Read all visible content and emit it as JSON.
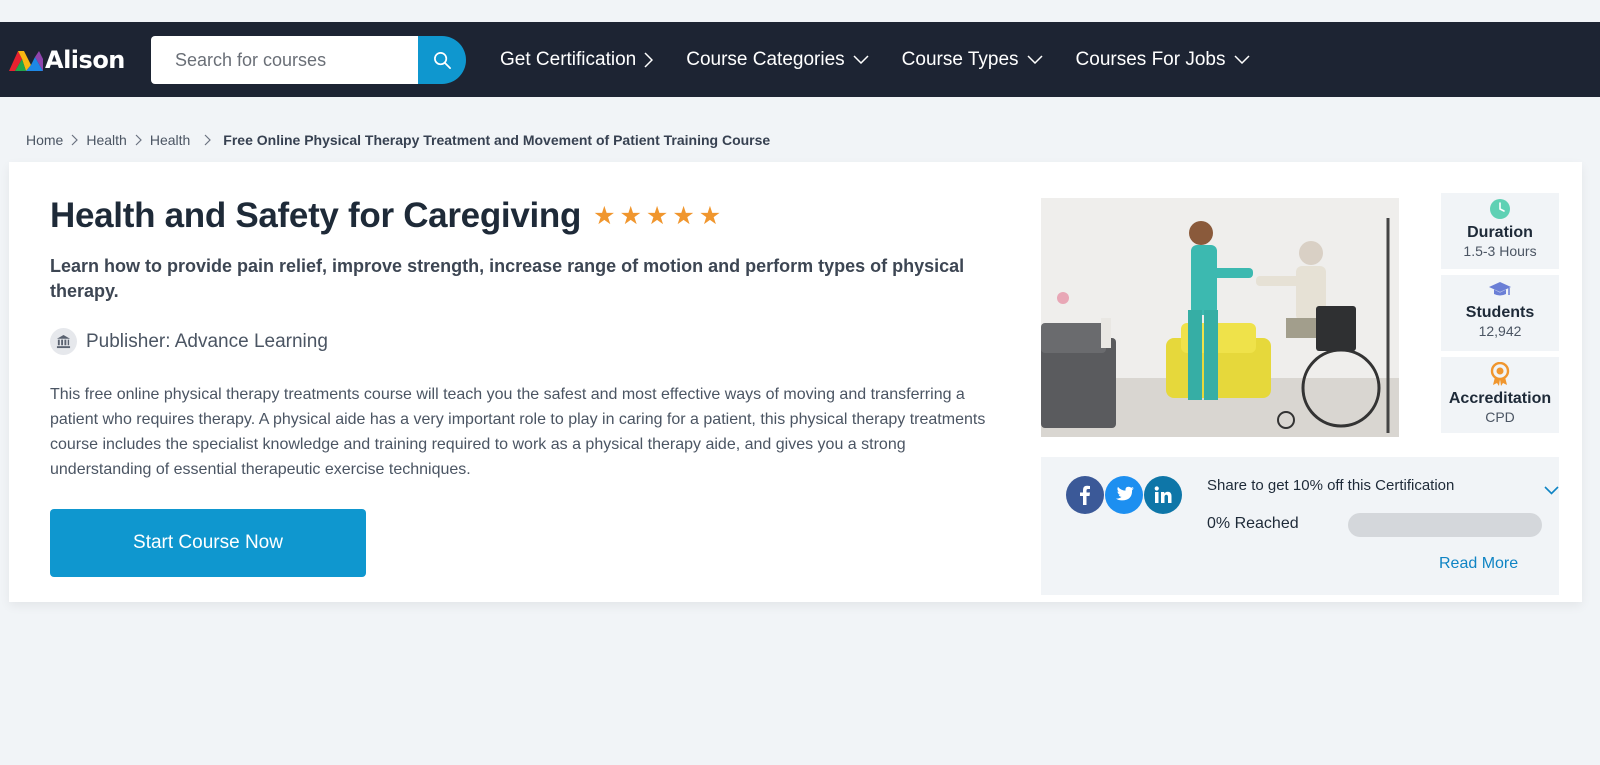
{
  "header": {
    "logo_text": "Alison",
    "search_placeholder": "Search for courses",
    "nav": [
      {
        "label": "Get Certification",
        "icon": "chevron-right-icon"
      },
      {
        "label": "Course Categories",
        "icon": "chevron-down-icon"
      },
      {
        "label": "Course Types",
        "icon": "chevron-down-icon"
      },
      {
        "label": "Courses For Jobs",
        "icon": "chevron-down-icon"
      }
    ]
  },
  "breadcrumb": [
    "Home",
    "Health",
    "Health",
    "Free Online Physical Therapy Treatment and Movement of Patient Training Course"
  ],
  "course": {
    "title": "Health and Safety for Caregiving",
    "rating": 5,
    "subtitle": "Learn how to provide pain relief, improve strength, increase range of motion and perform types of physical therapy.",
    "publisher": "Publisher: Advance Learning",
    "description": "This free online physical therapy treatments course will teach you the safest and most effective ways of moving and transferring a patient who requires therapy. A physical aide has a very important role to play in caring for a patient, this physical therapy treatments course includes the specialist knowledge and training required to work as a physical therapy aide, and gives you a strong understanding of essential therapeutic exercise techniques.",
    "start_button": "Start Course Now"
  },
  "stats": [
    {
      "label": "Duration",
      "value": "1.5-3 Hours",
      "icon": "clock-icon",
      "color": "#5fd1b4"
    },
    {
      "label": "Students",
      "value": "12,942",
      "icon": "graduation-cap-icon",
      "color": "#6b7fd6"
    },
    {
      "label": "Accreditation",
      "value": "CPD",
      "icon": "award-icon",
      "color": "#f0962e"
    }
  ],
  "share": {
    "text": "Share to get 10% off this Certification",
    "reached": "0% Reached",
    "progress": 0,
    "read_more": "Read More",
    "networks": [
      {
        "name": "facebook-icon",
        "color": "#3b5998"
      },
      {
        "name": "twitter-icon",
        "color": "#1d8ff0"
      },
      {
        "name": "linkedin-icon",
        "color": "#0e76a8"
      }
    ]
  },
  "colors": {
    "nav_bg": "#1d2433",
    "accent": "#0f97cf",
    "star": "#f0962e",
    "page_bg": "#f1f4f7"
  }
}
